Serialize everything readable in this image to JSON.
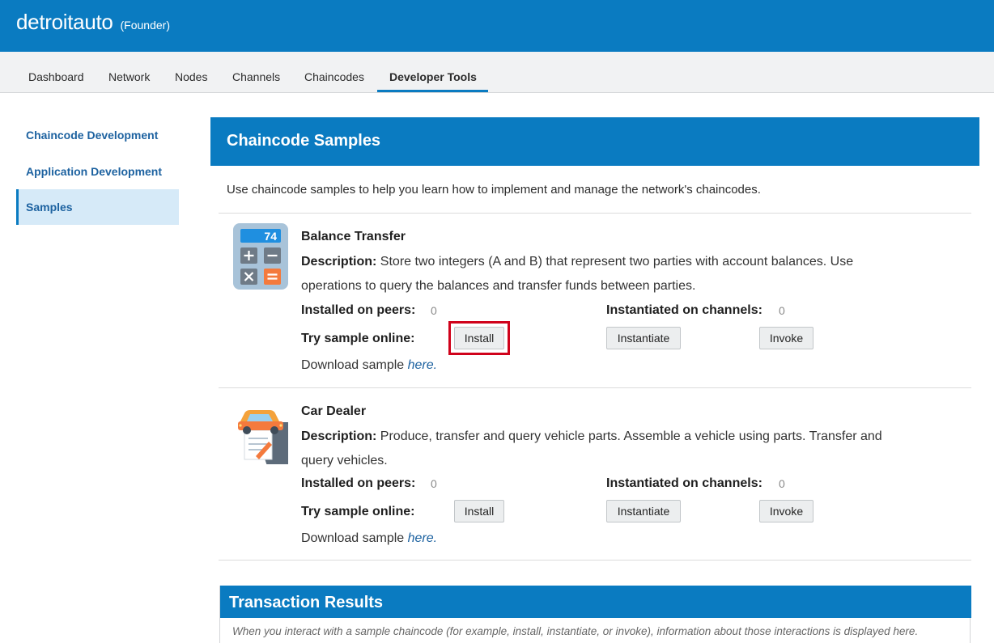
{
  "header": {
    "org_name": "detroitauto",
    "role": "(Founder)"
  },
  "tabs": [
    {
      "label": "Dashboard"
    },
    {
      "label": "Network"
    },
    {
      "label": "Nodes"
    },
    {
      "label": "Channels"
    },
    {
      "label": "Chaincodes"
    },
    {
      "label": "Developer Tools",
      "active": true
    }
  ],
  "sidebar": {
    "items": [
      {
        "label": "Chaincode Development"
      },
      {
        "label": "Application Development"
      },
      {
        "label": "Samples",
        "selected": true
      }
    ]
  },
  "main": {
    "title": "Chaincode Samples",
    "intro": "Use chaincode samples to help you learn how to implement and manage the network's chaincodes.",
    "labels": {
      "description": "Description:",
      "installed_on_peers": "Installed on peers:",
      "instantiated_on_channels": "Instantiated on channels:",
      "try_online": "Try sample online:",
      "download_prefix": "Download sample ",
      "download_link": "here."
    },
    "buttons": {
      "install": "Install",
      "instantiate": "Instantiate",
      "invoke": "Invoke"
    },
    "samples": [
      {
        "name": "Balance Transfer",
        "icon": "calculator-icon",
        "icon_display": "74",
        "description": "Store two integers (A and B) that represent two parties with account balances. Use operations to query the balances and transfer funds between parties.",
        "installed_count": "0",
        "instantiated_count": "0"
      },
      {
        "name": "Car Dealer",
        "icon": "car-document-icon",
        "description": "Produce, transfer and query vehicle parts. Assemble a vehicle using parts. Transfer and query vehicles.",
        "installed_count": "0",
        "instantiated_count": "0"
      }
    ]
  },
  "transaction_results": {
    "title": "Transaction Results",
    "text": "When you interact with a sample chaincode (for example, install, instantiate, or invoke), information about those interactions is displayed here."
  },
  "colors": {
    "brand_blue": "#0a7bc1",
    "link_blue": "#1d62a0",
    "selected_bg": "#d6eaf8",
    "highlight_red": "#d0021b"
  }
}
